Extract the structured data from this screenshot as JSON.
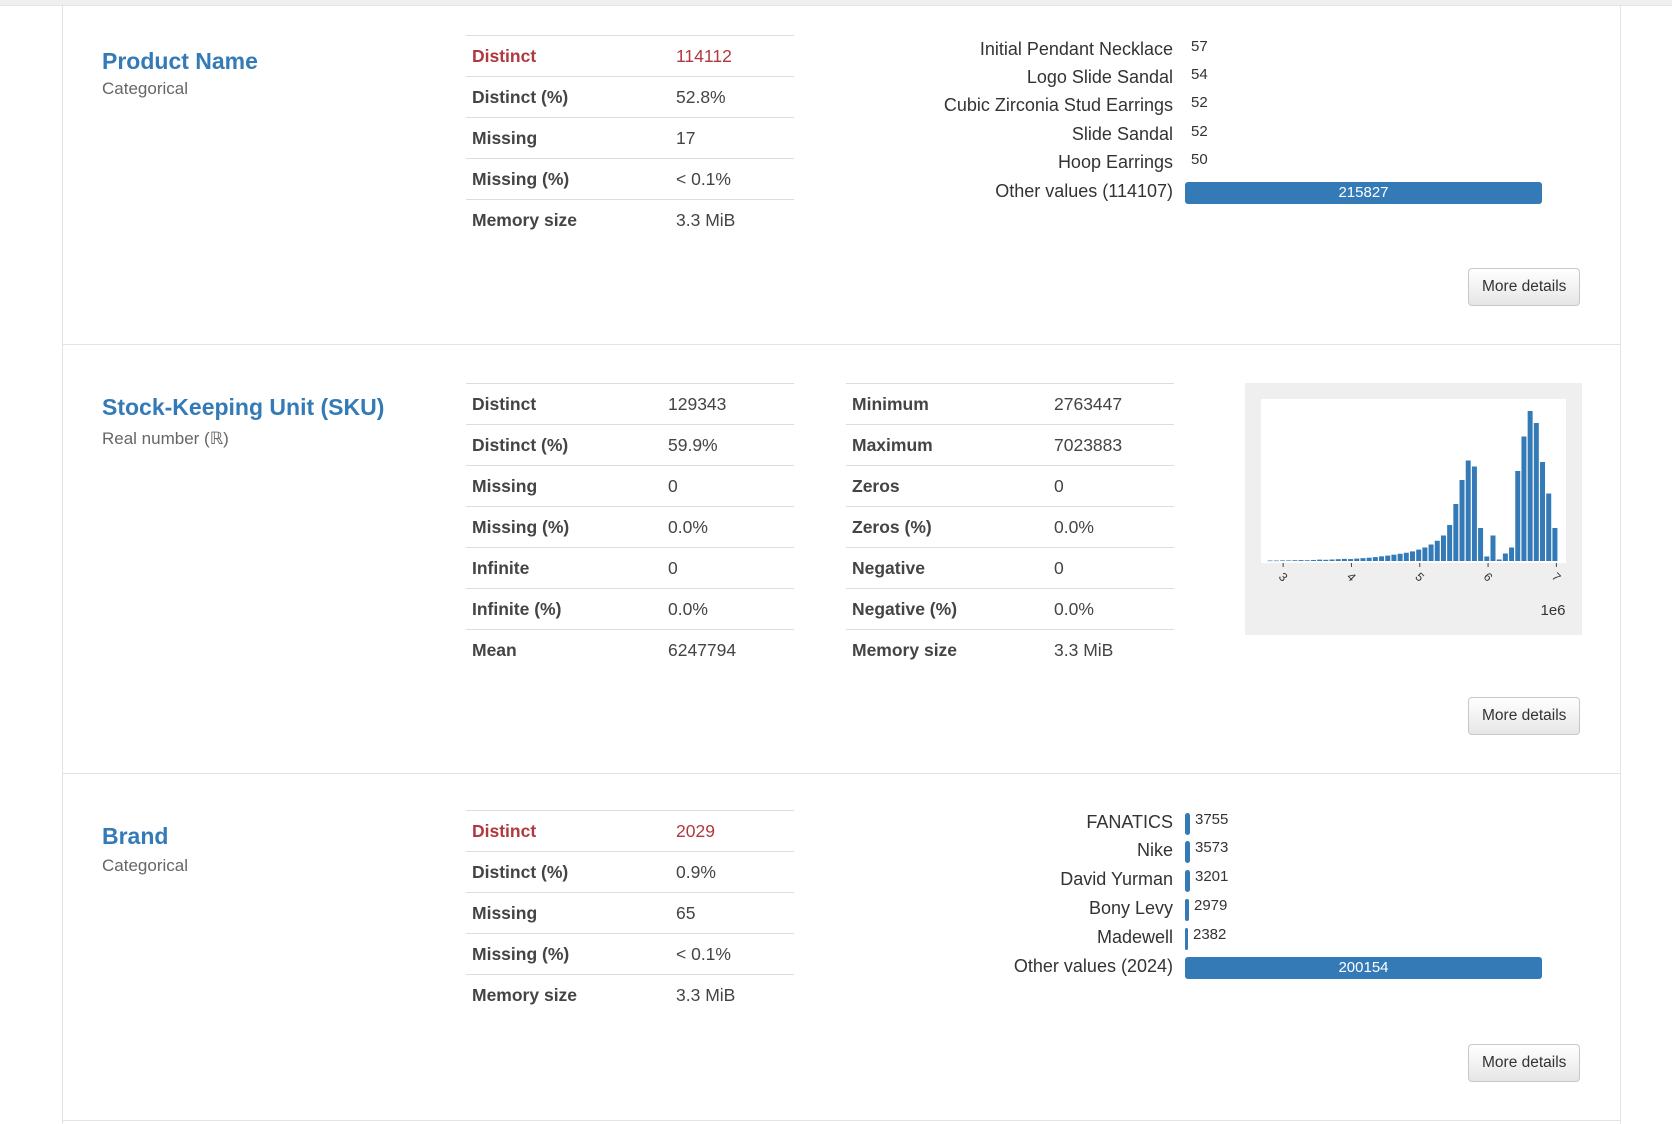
{
  "variables": [
    {
      "name": "Product Name",
      "type": "Categorical",
      "stats": [
        {
          "label": "Distinct",
          "value": "114112",
          "alert": true
        },
        {
          "label": "Distinct (%)",
          "value": "52.8%"
        },
        {
          "label": "Missing",
          "value": "17"
        },
        {
          "label": "Missing (%)",
          "value": "< 0.1%"
        },
        {
          "label": "Memory size",
          "value": "3.3 MiB"
        }
      ],
      "frequencies": [
        {
          "label": "Initial Pendant Necklace",
          "count": "57"
        },
        {
          "label": "Logo Slide Sandal",
          "count": "54"
        },
        {
          "label": "Cubic Zirconia Stud Earrings",
          "count": "52"
        },
        {
          "label": "Slide Sandal",
          "count": "52"
        },
        {
          "label": "Hoop Earrings",
          "count": "50"
        },
        {
          "label": "Other values (114107)",
          "count": "215827",
          "is_other": true
        }
      ],
      "more_details_label": "More details"
    },
    {
      "name": "Stock-Keeping Unit (SKU)",
      "type": "Real number (ℝ)",
      "stats_left": [
        {
          "label": "Distinct",
          "value": "129343"
        },
        {
          "label": "Distinct (%)",
          "value": "59.9%"
        },
        {
          "label": "Missing",
          "value": "0"
        },
        {
          "label": "Missing (%)",
          "value": "0.0%"
        },
        {
          "label": "Infinite",
          "value": "0"
        },
        {
          "label": "Infinite (%)",
          "value": "0.0%"
        },
        {
          "label": "Mean",
          "value": "6247794"
        }
      ],
      "stats_right": [
        {
          "label": "Minimum",
          "value": "2763447"
        },
        {
          "label": "Maximum",
          "value": "7023883"
        },
        {
          "label": "Zeros",
          "value": "0"
        },
        {
          "label": "Zeros (%)",
          "value": "0.0%"
        },
        {
          "label": "Negative",
          "value": "0"
        },
        {
          "label": "Negative (%)",
          "value": "0.0%"
        },
        {
          "label": "Memory size",
          "value": "3.3 MiB"
        }
      ],
      "more_details_label": "More details"
    },
    {
      "name": "Brand",
      "type": "Categorical",
      "stats": [
        {
          "label": "Distinct",
          "value": "2029",
          "alert": true
        },
        {
          "label": "Distinct (%)",
          "value": "0.9%"
        },
        {
          "label": "Missing",
          "value": "65"
        },
        {
          "label": "Missing (%)",
          "value": "< 0.1%"
        },
        {
          "label": "Memory size",
          "value": "3.3 MiB"
        }
      ],
      "frequencies": [
        {
          "label": "FANATICS",
          "count": "3755"
        },
        {
          "label": "Nike",
          "count": "3573"
        },
        {
          "label": "David Yurman",
          "count": "3201"
        },
        {
          "label": "Bony Levy",
          "count": "2979"
        },
        {
          "label": "Madewell",
          "count": "2382"
        },
        {
          "label": "Other values (2024)",
          "count": "200154",
          "is_other": true
        }
      ],
      "more_details_label": "More details"
    }
  ],
  "chart_data": {
    "type": "bar",
    "x_ticks": [
      "3",
      "4",
      "5",
      "6",
      "7"
    ],
    "x_scale_label": "1e6",
    "xlim": [
      2763447,
      7023883
    ],
    "bins": [
      0.3,
      0.3,
      0.4,
      0.4,
      0.5,
      0.6,
      0.5,
      0.7,
      0.9,
      0.8,
      1.0,
      1.2,
      1.4,
      1.3,
      1.6,
      1.9,
      2.2,
      2.6,
      3.1,
      3.6,
      4.2,
      4.8,
      5.5,
      6.4,
      7.6,
      9.0,
      11.0,
      13.5,
      17.0,
      24.0,
      38.0,
      54.0,
      67.0,
      63.0,
      22.0,
      3.0,
      17.0,
      1.0,
      5.0,
      9.0,
      60.0,
      83.0,
      100.0,
      92.0,
      66.0,
      45.0,
      22.0
    ],
    "bar_color": "#337ab7",
    "background_color": "#efefef"
  },
  "colors": {
    "accent": "#337ab7",
    "alert": "#b0383e"
  }
}
